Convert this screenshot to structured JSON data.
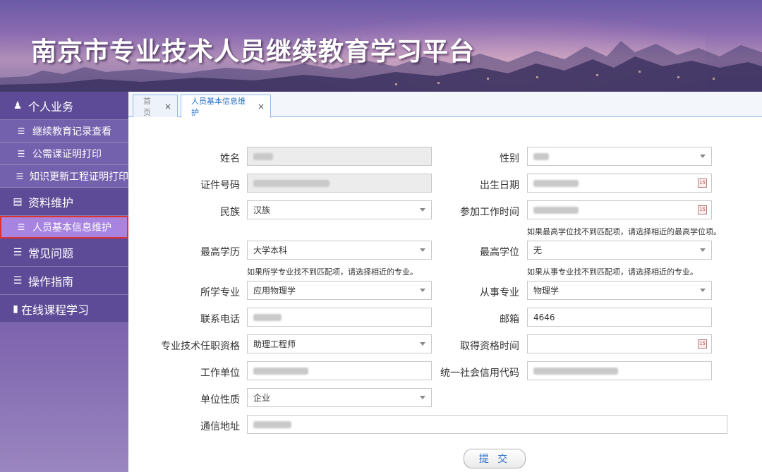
{
  "header": {
    "title": "南京市专业技术人员继续教育学习平台"
  },
  "sidebar": {
    "sections": [
      {
        "label": "个人业务",
        "icon": "person-icon"
      },
      {
        "label": "资料维护",
        "icon": "book-icon"
      },
      {
        "label": "常见问题",
        "icon": "list-icon"
      },
      {
        "label": "操作指南",
        "icon": "list-icon"
      },
      {
        "label": "在线课程学习",
        "icon": "monitor-icon"
      }
    ],
    "items": [
      {
        "label": "继续教育记录查看"
      },
      {
        "label": "公需课证明打印"
      },
      {
        "label": "知识更新工程证明打印"
      },
      {
        "label": "人员基本信息维护"
      }
    ]
  },
  "tabs": [
    {
      "label": "首页",
      "close": "×"
    },
    {
      "label": "人员基本信息维护",
      "close": "×"
    }
  ],
  "form": {
    "name_label": "姓名",
    "gender_label": "性别",
    "id_label": "证件号码",
    "birth_label": "出生日期",
    "ethnic_label": "民族",
    "ethnic_value": "汉族",
    "work_start_label": "参加工作时间",
    "degree_hint": "如果最高学位找不到匹配项，请选择相近的最高学位项。",
    "education_label": "最高学历",
    "education_value": "大学本科",
    "degree_label": "最高学位",
    "degree_value": "无",
    "major_hint": "如果所学专业找不到匹配项，请选择相近的专业。",
    "work_major_hint": "如果从事专业找不到匹配项，请选择相近的专业。",
    "major_label": "所学专业",
    "major_value": "应用物理学",
    "work_major_label": "从事专业",
    "work_major_value": "物理学",
    "phone_label": "联系电话",
    "email_label": "邮箱",
    "email_value": "4646",
    "title_label": "专业技术任职资格",
    "title_value": "助理工程师",
    "qual_time_label": "取得资格时间",
    "employer_label": "工作单位",
    "credit_code_label": "统一社会信用代码",
    "org_type_label": "单位性质",
    "org_type_value": "企业",
    "address_label": "通信地址",
    "calendar_glyph": "15",
    "submit_label": "提 交"
  },
  "colors": {
    "accent": "#2a6fc9",
    "sidebar": "#6c59a8",
    "active_item": "#a684e0",
    "highlight_border": "#e0312f"
  }
}
